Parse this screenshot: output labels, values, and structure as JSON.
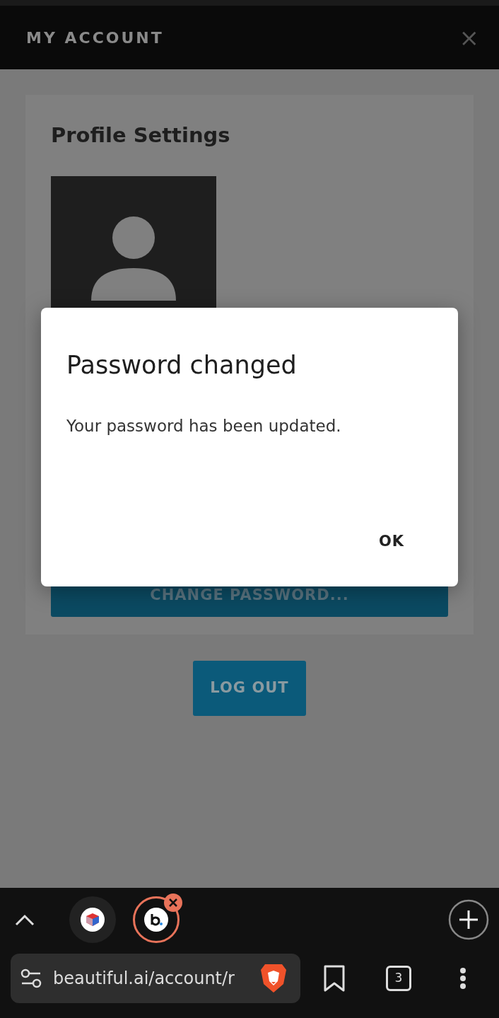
{
  "header": {
    "title": "MY ACCOUNT",
    "close": "×"
  },
  "profile": {
    "title": "Profile Settings",
    "change_password": "CHANGE PASSWORD..."
  },
  "logout": "LOG OUT",
  "dialog": {
    "title": "Password changed",
    "message": "Your password has been updated.",
    "ok": "OK"
  },
  "browser": {
    "tabs": [
      {
        "selected": false
      },
      {
        "selected": true
      }
    ],
    "url": "beautiful.ai/account/r",
    "tab_count": "3"
  }
}
